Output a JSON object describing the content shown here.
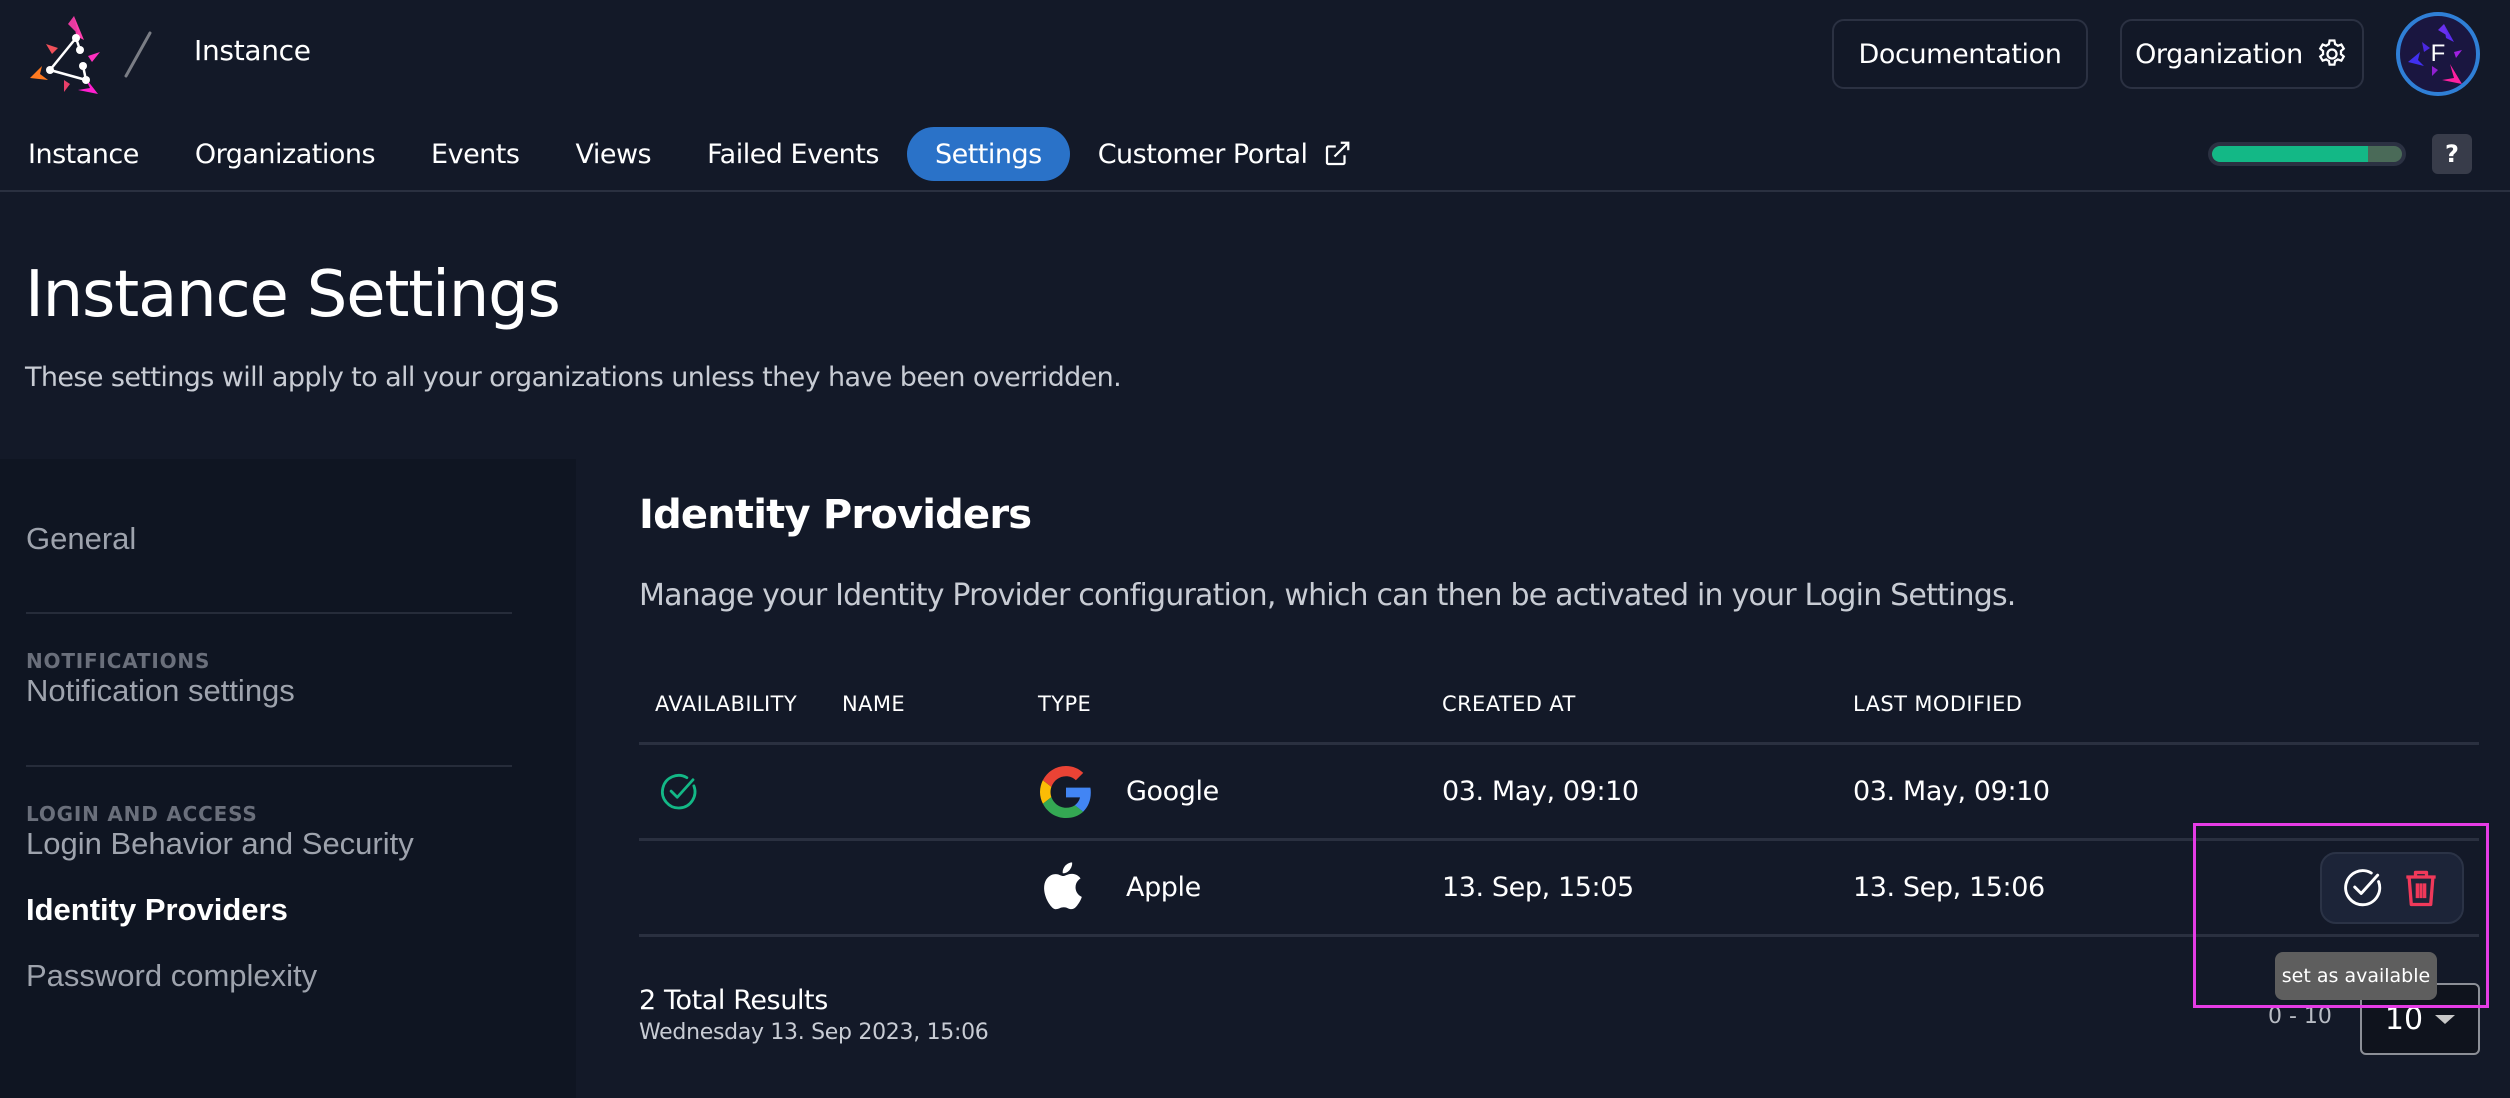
{
  "header": {
    "breadcrumb": "Instance",
    "documentation_label": "Documentation",
    "organization_label": "Organization",
    "avatar_letter": "F"
  },
  "nav": {
    "items": [
      {
        "label": "Instance",
        "active": false
      },
      {
        "label": "Organizations",
        "active": false
      },
      {
        "label": "Events",
        "active": false
      },
      {
        "label": "Views",
        "active": false
      },
      {
        "label": "Failed Events",
        "active": false
      },
      {
        "label": "Settings",
        "active": true
      },
      {
        "label": "Customer Portal",
        "active": false,
        "icon": "external-link-icon"
      }
    ],
    "progress_percent": 82,
    "help_label": "?"
  },
  "page": {
    "title": "Instance Settings",
    "subtitle": "These settings will apply to all your organizations unless they have been overridden."
  },
  "sidebar": {
    "general": "General",
    "sections": [
      {
        "title": "NOTIFICATIONS",
        "items": [
          "Notification settings"
        ]
      },
      {
        "title": "LOGIN AND ACCESS",
        "items": [
          "Login Behavior and Security",
          "Identity Providers",
          "Password complexity"
        ]
      }
    ],
    "active_item": "Identity Providers"
  },
  "main": {
    "title": "Identity Providers",
    "description": "Manage your Identity Provider configuration, which can then be activated in your Login Settings.",
    "table": {
      "columns": [
        "AVAILABILITY",
        "NAME",
        "TYPE",
        "CREATED AT",
        "LAST MODIFIED"
      ],
      "rows": [
        {
          "available": true,
          "name": "",
          "type": "Google",
          "type_icon": "google-icon",
          "created_at": "03. May, 09:10",
          "last_modified": "03. May, 09:10"
        },
        {
          "available": false,
          "name": "",
          "type": "Apple",
          "type_icon": "apple-icon",
          "created_at": "13. Sep, 15:05",
          "last_modified": "13. Sep, 15:06"
        }
      ]
    },
    "row_actions": {
      "set_available_icon": "check-circle-icon",
      "delete_icon": "trash-icon",
      "tooltip": "set as available"
    },
    "footer": {
      "total_results": "2 Total Results",
      "timestamp": "Wednesday 13. Sep 2023, 15:06",
      "page_range": "0 - 10",
      "page_size": "10"
    }
  },
  "colors": {
    "background": "#131928",
    "sidebar_background": "#0f1522",
    "accent": "#2a72c8",
    "success": "#13b886",
    "danger": "#f0395a",
    "highlight": "#e63ce6"
  }
}
